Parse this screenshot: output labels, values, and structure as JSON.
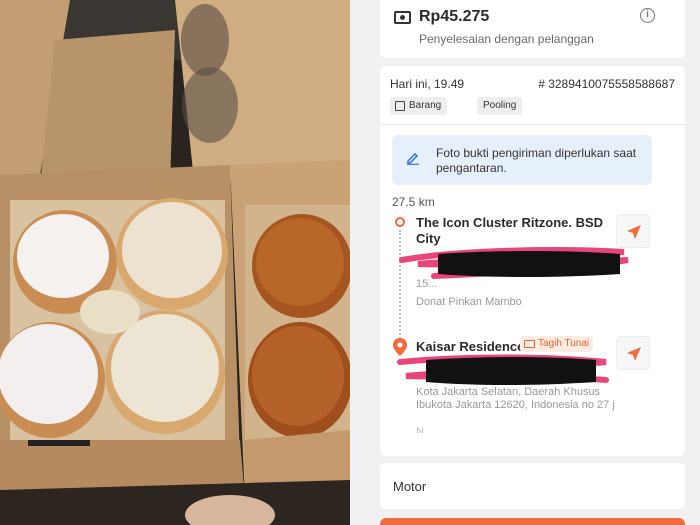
{
  "fare": {
    "amount": "Rp45.275",
    "subtitle": "Penyelesaian dengan pelanggan",
    "info_icon": "info-icon",
    "info_glyph": "i"
  },
  "order": {
    "time": "Hari ini, 19.49",
    "id": "# 3289410075558588687",
    "tags": [
      "Barang",
      "Pooling"
    ],
    "notice": "Foto bukti pengiriman diperlukan saat pengantaran.",
    "distance": "27.5 km"
  },
  "pickup": {
    "name": "The Icon Cluster Ritzone. BSD City",
    "address_partial": "15...",
    "store": "Donat Pinkan Mambo"
  },
  "destination": {
    "name": "Kaisar Residence",
    "payment_tag": "Tagih Tunai",
    "address": "Kota Jakarta Selatan, Daerah Khusus Ibukota Jakarta 12620, Indonesia no 27 j",
    "address_tail": "N..."
  },
  "vehicle": {
    "label": "Motor"
  },
  "colors": {
    "accent": "#f26b3a",
    "redaction": "#e9457a",
    "notice_bg": "#e6f0fb"
  }
}
